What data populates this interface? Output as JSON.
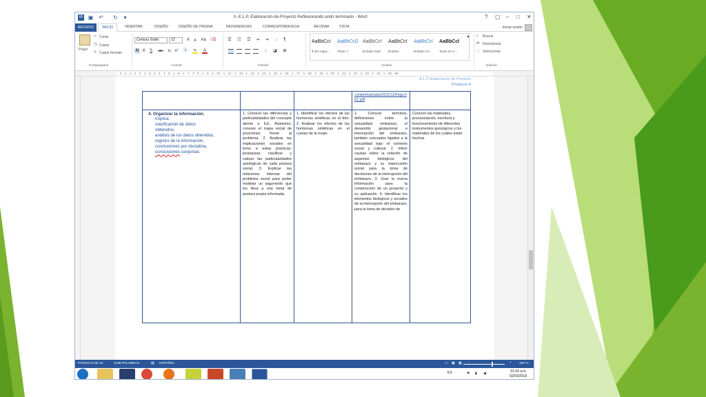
{
  "window": {
    "title": "h.-E.L.P.-Elaboración-de-Proyecto Reflexionando ando terminado - Word",
    "help": "?",
    "min": "–",
    "max": "□",
    "close": "✕",
    "restore": "▢"
  },
  "ribbon_tabs": {
    "archivo": "ARCHIVO",
    "inicio": "INICIO",
    "insertar": "INSERTAR",
    "diseno": "DISEÑO",
    "diseno_pagina": "DISEÑO DE PÁGINA",
    "referencias": "REFERENCIAS",
    "correspondencia": "CORRESPONDENCIA",
    "revisar": "REVISAR",
    "vista": "VISTA",
    "signin": "Iniciar sesión"
  },
  "clipboard": {
    "paste": "Pegar",
    "cut": "Cortar",
    "copy": "Copiar",
    "format_painter": "Copiar formato",
    "label": "Portapapeles"
  },
  "font": {
    "name": "Century Gothi",
    "size": "12",
    "label": "Fuente",
    "grow": "A",
    "shrink": "A",
    "case": "Aa",
    "bold": "N",
    "italic": "K",
    "underline": "S",
    "strike": "abc",
    "sub": "x₂",
    "sup": "x²"
  },
  "paragraph": {
    "label": "Párrafo",
    "mark": "¶",
    "sort": "↓"
  },
  "styles": {
    "label": "Estilos",
    "items": [
      {
        "preview": "AaBbCcI",
        "name": "¶ Sin espa..."
      },
      {
        "preview": "AaBbCcD",
        "name": "Título 7"
      },
      {
        "preview": "AaBbCcI",
        "name": "Énfasis sutil"
      },
      {
        "preview": "AaBbCcI",
        "name": "Énfasis"
      },
      {
        "preview": "AaBbCcI",
        "name": "Énfasis int..."
      },
      {
        "preview": "AaBbCcI",
        "name": "Texto en n..."
      }
    ]
  },
  "editing": {
    "label": "Edición",
    "find": "Buscar",
    "replace": "Reemplazar",
    "select": "Seleccionar"
  },
  "ruler": {
    "numbers": "· 2 · 1 · 1 · 1 · 2 · 1 · 3 · 1 · 4 · 1 · 5 · 1 · 6 · 1 · 7 · 1 · 8 · 1 · 9 · 1 · 10 · 1 · 11 · 1 · 12 · 1 · 13 · 1 · 14 · 1 · 15 · 1 · 16 · 1 · 17 · 1 · 18 · 1 · 19 · 1 · 20 · 1 · 21 · 1 · 22 · 1 · 23 · 1 · 24 · 1 · 25 · 26"
  },
  "page_header": {
    "line1": "E.L.P.-Elaboración de Proyecto",
    "line2": "Producto 8"
  },
  "table": {
    "top_link": "content/uploads/2011/12/Hoja-001.pdf",
    "row": {
      "col1_title": "4. Organizar la información.",
      "col1_lines": [
        "Implica:",
        "clasificación de datos",
        "obtenidos,",
        "análisis de los datos obtenidos,",
        "registro de la información,",
        "conclusiones por disciplina,"
      ],
      "col1_last_word": "conclusiones",
      "col1_last_rest": " conjuntas.",
      "col2": "1. Conocer las diferencias y particularidades del concepto aborto e ILE. Asimismo, conocer el mapa social de posiciones frente al problema. 2. Analizar las implicaciones sociales en torno a estas prácticas: jerarquizar, clasificar y valorar las particularidades axiológicas de cada postura social. 3. Explicar las relaciones internas del problema social para poder modelar un argumento que los lleva a una toma de postura propia informada.",
      "col3": "1. Identificar los efectos de las hormonas sintéticas en el feto. 2. Analizar los efectos de las hormonas sintéticas en el cuerpo de la mujer.",
      "col4": "1. Conocer términos, definiciones sobre la sexualidad, embarazo, el desarrollo gestacional e interrupción del embarazo, también conceptos ligados a la sexualidad bajo el contexto social y cultural. 2. Inferir causas sobre la relación de aspectos biológicos del embarazo y su repercusión social para la toma de decisiones de la interrupción del embarazo. 3. Usar la nueva información para la construcción de un proyecto y su aplicación. 4. Identificar los elementos biológicos y sociales de la interrupción del embarazo, para la toma de decisión de",
      "col5": "Conocer las materiales, pronunciación, escritura y funcionamiento de diferentes instrumentos quirúrgicos y los materiales de los cuales están hechos."
    }
  },
  "status": {
    "page": "PÁGINA 8 DE 12",
    "words": "2198 PALABRAS",
    "lang": "ESPAÑOL",
    "zoom": "100 %",
    "zoom_level_percent": 100
  },
  "taskbar": {
    "lang": "ES",
    "time": "01:42 a.m.",
    "date": "02/03/2018"
  },
  "colors": {
    "word_blue": "#2b579a",
    "table_border": "#2f5597",
    "green_dark": "#4a9a1c",
    "green_light": "#8cc63f"
  }
}
